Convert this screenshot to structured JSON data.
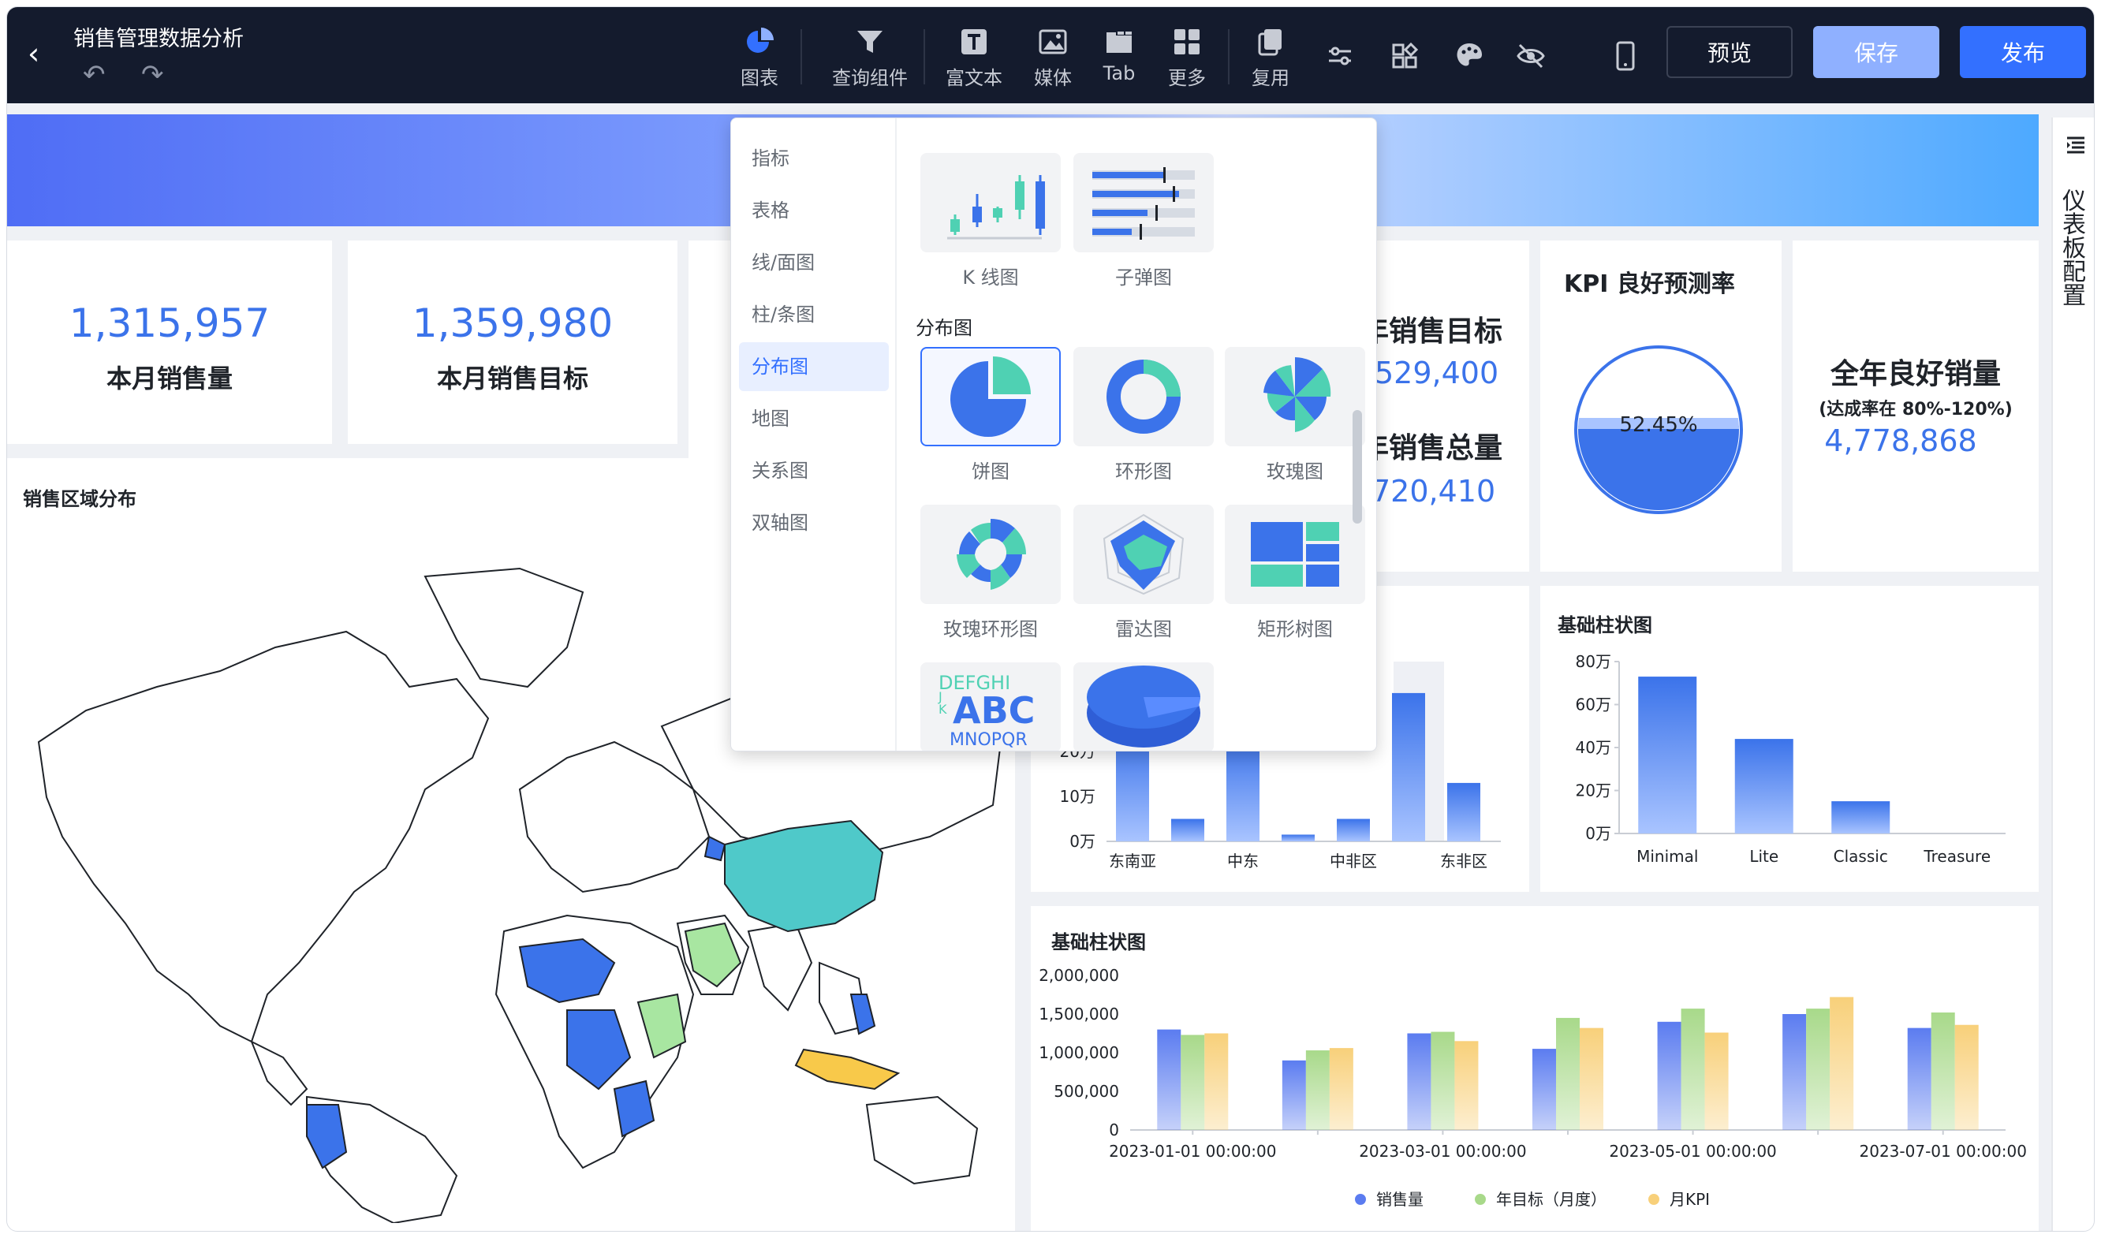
{
  "header": {
    "title": "销售管理数据分析",
    "tools": [
      {
        "name": "chart",
        "label": "图表"
      },
      {
        "name": "query",
        "label": "查询组件"
      },
      {
        "name": "richtext",
        "label": "富文本"
      },
      {
        "name": "media",
        "label": "媒体"
      },
      {
        "name": "tab",
        "label": "Tab"
      },
      {
        "name": "more",
        "label": "更多"
      },
      {
        "name": "reuse",
        "label": "复用"
      }
    ],
    "preview_label": "预览",
    "save_label": "保存",
    "publish_label": "发布"
  },
  "right_panel": {
    "label": "仪表板配置"
  },
  "kpis": [
    {
      "value": "1,315,957",
      "label": "本月销售量"
    },
    {
      "value": "1,359,980",
      "label": "本月销售目标"
    }
  ],
  "partial_kpi": {
    "target_label_visible": "年销售目标",
    "target_value_visible": "529,400",
    "total_label_visible": "年销售总量",
    "total_value_visible": "720,410"
  },
  "kpi_rate": {
    "title": "KPI 良好预测率",
    "value": "52.45%",
    "fraction": 0.5245
  },
  "good_sales": {
    "title": "全年良好销量",
    "subtitle": "(达成率在 80%-120%)",
    "value": "4,778,868"
  },
  "map": {
    "title": "销售区域分布"
  },
  "dropdown": {
    "categories": [
      "指标",
      "表格",
      "线/面图",
      "柱/条图",
      "分布图",
      "地图",
      "关系图",
      "双轴图"
    ],
    "active_category": "分布图",
    "top_items": [
      {
        "name": "kline",
        "label": "K 线图"
      },
      {
        "name": "bullet",
        "label": "子弹图"
      }
    ],
    "section_title": "分布图",
    "items": [
      {
        "name": "pie",
        "label": "饼图"
      },
      {
        "name": "donut",
        "label": "环形图"
      },
      {
        "name": "rose",
        "label": "玫瑰图"
      },
      {
        "name": "rose-donut",
        "label": "玫瑰环形图"
      },
      {
        "name": "radar",
        "label": "雷达图"
      },
      {
        "name": "treemap",
        "label": "矩形树图"
      }
    ],
    "wordcloud_text": {
      "line1": "DEFGHI",
      "line2": "ABC",
      "line3": "MNOPQR",
      "side": "J K"
    }
  },
  "chart_data": [
    {
      "type": "bar",
      "categories": [
        "东南亚",
        "",
        "中东",
        "",
        "中非区",
        "",
        "东非区"
      ],
      "tick_labels": [
        "东南亚",
        "中东",
        "中非区",
        "东非区"
      ],
      "values": [
        24,
        5,
        23,
        1.5,
        5,
        33,
        13
      ],
      "ylabel_ticks": [
        "0万",
        "10万",
        "20万"
      ],
      "ylim": [
        0,
        40
      ]
    },
    {
      "type": "bar",
      "title": "基础柱状图",
      "categories": [
        "Minimal",
        "Lite",
        "Classic",
        "Treasure"
      ],
      "values": [
        73,
        44,
        15,
        0
      ],
      "yticks": [
        "0万",
        "20万",
        "40万",
        "60万",
        "80万"
      ],
      "ylim": [
        0,
        80
      ]
    },
    {
      "type": "bar",
      "title": "基础柱状图",
      "x": [
        "2023-01-01 00:00:00",
        "",
        "2023-03-01 00:00:00",
        "",
        "2023-05-01 00:00:00",
        "",
        "2023-07-01 00:00:00"
      ],
      "x_tick_labels": [
        "2023-01-01 00:00:00",
        "2023-03-01 00:00:00",
        "2023-05-01 00:00:00",
        "2023-07-01 00:00:00"
      ],
      "series": [
        {
          "name": "销售量",
          "values": [
            1300000,
            900000,
            1250000,
            1050000,
            1400000,
            1500000,
            1320000
          ],
          "color": "#5b7cf0"
        },
        {
          "name": "年目标（月度）",
          "values": [
            1230000,
            1030000,
            1270000,
            1450000,
            1570000,
            1570000,
            1520000
          ],
          "color": "#a8d98a"
        },
        {
          "name": "月KPI",
          "values": [
            1250000,
            1060000,
            1150000,
            1320000,
            1260000,
            1720000,
            1360000
          ],
          "color": "#f8d07a"
        }
      ],
      "yticks": [
        "0",
        "500,000",
        "1,000,000",
        "1,500,000",
        "2,000,000"
      ],
      "ylim": [
        0,
        2000000
      ]
    }
  ],
  "colors": {
    "accent": "#3370ff",
    "kpi_blue": "#3b73ea",
    "teal": "#4fd1c5",
    "map_blue": "#3b73ea",
    "map_green": "#a8e6a1",
    "map_yellow": "#f8c94a"
  }
}
